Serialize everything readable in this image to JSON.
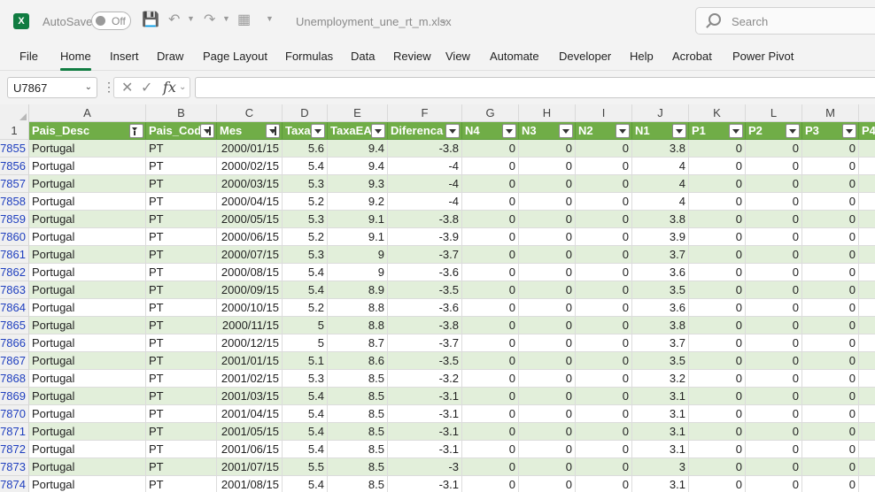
{
  "titlebar": {
    "autosave_label": "AutoSave",
    "autosave_state": "Off",
    "filename": "Unemployment_une_rt_m.xlsx",
    "search_placeholder": "Search"
  },
  "ribbon": {
    "tabs": [
      "File",
      "Home",
      "Insert",
      "Draw",
      "Page Layout",
      "Formulas",
      "Data",
      "Review",
      "View",
      "Automate",
      "Developer",
      "Help",
      "Acrobat",
      "Power Pivot"
    ],
    "active_tab": "Home"
  },
  "formula_bar": {
    "name_box": "U7867",
    "fx_label": "fx",
    "formula": ""
  },
  "sheet": {
    "header_row_number": "1",
    "columns": [
      "A",
      "B",
      "C",
      "D",
      "E",
      "F",
      "G",
      "H",
      "I",
      "J",
      "K",
      "L",
      "M"
    ],
    "headers": [
      "Pais_Desc",
      "Pais_Cod",
      "Mes",
      "Taxa",
      "TaxaEA",
      "Diferenca",
      "N4",
      "N3",
      "N2",
      "N1",
      "P1",
      "P2",
      "P3",
      "P4"
    ],
    "rows": [
      {
        "n": "7855",
        "cells": [
          "Portugal",
          "PT",
          "2000/01/15",
          "5.6",
          "9.4",
          "-3.8",
          "0",
          "0",
          "0",
          "3.8",
          "0",
          "0",
          "0"
        ]
      },
      {
        "n": "7856",
        "cells": [
          "Portugal",
          "PT",
          "2000/02/15",
          "5.4",
          "9.4",
          "-4",
          "0",
          "0",
          "0",
          "4",
          "0",
          "0",
          "0"
        ]
      },
      {
        "n": "7857",
        "cells": [
          "Portugal",
          "PT",
          "2000/03/15",
          "5.3",
          "9.3",
          "-4",
          "0",
          "0",
          "0",
          "4",
          "0",
          "0",
          "0"
        ]
      },
      {
        "n": "7858",
        "cells": [
          "Portugal",
          "PT",
          "2000/04/15",
          "5.2",
          "9.2",
          "-4",
          "0",
          "0",
          "0",
          "4",
          "0",
          "0",
          "0"
        ]
      },
      {
        "n": "7859",
        "cells": [
          "Portugal",
          "PT",
          "2000/05/15",
          "5.3",
          "9.1",
          "-3.8",
          "0",
          "0",
          "0",
          "3.8",
          "0",
          "0",
          "0"
        ]
      },
      {
        "n": "7860",
        "cells": [
          "Portugal",
          "PT",
          "2000/06/15",
          "5.2",
          "9.1",
          "-3.9",
          "0",
          "0",
          "0",
          "3.9",
          "0",
          "0",
          "0"
        ]
      },
      {
        "n": "7861",
        "cells": [
          "Portugal",
          "PT",
          "2000/07/15",
          "5.3",
          "9",
          "-3.7",
          "0",
          "0",
          "0",
          "3.7",
          "0",
          "0",
          "0"
        ]
      },
      {
        "n": "7862",
        "cells": [
          "Portugal",
          "PT",
          "2000/08/15",
          "5.4",
          "9",
          "-3.6",
          "0",
          "0",
          "0",
          "3.6",
          "0",
          "0",
          "0"
        ]
      },
      {
        "n": "7863",
        "cells": [
          "Portugal",
          "PT",
          "2000/09/15",
          "5.4",
          "8.9",
          "-3.5",
          "0",
          "0",
          "0",
          "3.5",
          "0",
          "0",
          "0"
        ]
      },
      {
        "n": "7864",
        "cells": [
          "Portugal",
          "PT",
          "2000/10/15",
          "5.2",
          "8.8",
          "-3.6",
          "0",
          "0",
          "0",
          "3.6",
          "0",
          "0",
          "0"
        ]
      },
      {
        "n": "7865",
        "cells": [
          "Portugal",
          "PT",
          "2000/11/15",
          "5",
          "8.8",
          "-3.8",
          "0",
          "0",
          "0",
          "3.8",
          "0",
          "0",
          "0"
        ]
      },
      {
        "n": "7866",
        "cells": [
          "Portugal",
          "PT",
          "2000/12/15",
          "5",
          "8.7",
          "-3.7",
          "0",
          "0",
          "0",
          "3.7",
          "0",
          "0",
          "0"
        ]
      },
      {
        "n": "7867",
        "cells": [
          "Portugal",
          "PT",
          "2001/01/15",
          "5.1",
          "8.6",
          "-3.5",
          "0",
          "0",
          "0",
          "3.5",
          "0",
          "0",
          "0"
        ]
      },
      {
        "n": "7868",
        "cells": [
          "Portugal",
          "PT",
          "2001/02/15",
          "5.3",
          "8.5",
          "-3.2",
          "0",
          "0",
          "0",
          "3.2",
          "0",
          "0",
          "0"
        ]
      },
      {
        "n": "7869",
        "cells": [
          "Portugal",
          "PT",
          "2001/03/15",
          "5.4",
          "8.5",
          "-3.1",
          "0",
          "0",
          "0",
          "3.1",
          "0",
          "0",
          "0"
        ]
      },
      {
        "n": "7870",
        "cells": [
          "Portugal",
          "PT",
          "2001/04/15",
          "5.4",
          "8.5",
          "-3.1",
          "0",
          "0",
          "0",
          "3.1",
          "0",
          "0",
          "0"
        ]
      },
      {
        "n": "7871",
        "cells": [
          "Portugal",
          "PT",
          "2001/05/15",
          "5.4",
          "8.5",
          "-3.1",
          "0",
          "0",
          "0",
          "3.1",
          "0",
          "0",
          "0"
        ]
      },
      {
        "n": "7872",
        "cells": [
          "Portugal",
          "PT",
          "2001/06/15",
          "5.4",
          "8.5",
          "-3.1",
          "0",
          "0",
          "0",
          "3.1",
          "0",
          "0",
          "0"
        ]
      },
      {
        "n": "7873",
        "cells": [
          "Portugal",
          "PT",
          "2001/07/15",
          "5.5",
          "8.5",
          "-3",
          "0",
          "0",
          "0",
          "3",
          "0",
          "0",
          "0"
        ]
      },
      {
        "n": "7874",
        "cells": [
          "Portugal",
          "PT",
          "2001/08/15",
          "5.4",
          "8.5",
          "-3.1",
          "0",
          "0",
          "0",
          "3.1",
          "0",
          "0",
          "0"
        ]
      }
    ]
  },
  "colors": {
    "header_green": "#70ad47",
    "band_green": "#e2efda",
    "accent": "#107c41",
    "row_number": "#1f3fbf"
  }
}
